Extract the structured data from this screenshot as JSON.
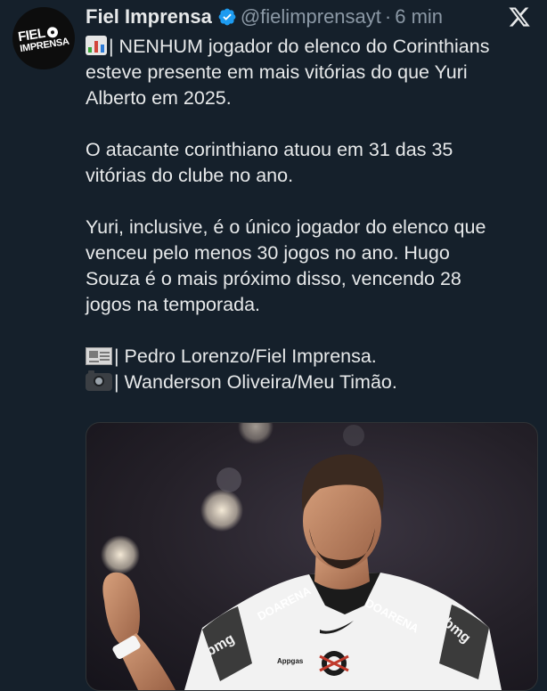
{
  "account": {
    "name": "Fiel Imprensa",
    "handle": "@fielimprensayt",
    "separator": "·",
    "time": "6 min",
    "avatar_logo_line1_a": "FIEL",
    "avatar_logo_line2": "IMPRENSA",
    "verified_color": "#1d9bf0"
  },
  "tweet": {
    "para1": [
      "| NENHUM jogador do elenco do Corinthians",
      "esteve presente em mais vitórias do que Yuri",
      "Alberto em 2025."
    ],
    "para2": [
      "O atacante corinthiano atuou em 31 das 35",
      "vitórias do clube no ano."
    ],
    "para3": [
      "Yuri, inclusive, é o único jogador do elenco que",
      "venceu pelo menos 30 jogos no ano. Hugo",
      "Souza é o mais próximo disso, vencendo 28",
      "jogos na temporada."
    ],
    "credit_text": "| Pedro Lorenzo/Fiel Imprensa.",
    "credit_photo": "| Wanderson Oliveira/Meu Timão."
  },
  "photo": {
    "sponsor_front": "DOARENA",
    "sponsor_sleeve_left": "bmg",
    "sponsor_sleeve_right": "bmg",
    "sponsor_chest": "Appgas"
  },
  "icons": {
    "verified": "verified-badge-icon",
    "x_logo": "x-logo-icon",
    "chart_emoji": "bar-chart-emoji-icon",
    "news_emoji": "newspaper-emoji-icon",
    "camera_emoji": "camera-emoji-icon"
  },
  "colors": {
    "background": "#15202b",
    "text": "#e7e9ea",
    "muted": "#8b98a5"
  }
}
